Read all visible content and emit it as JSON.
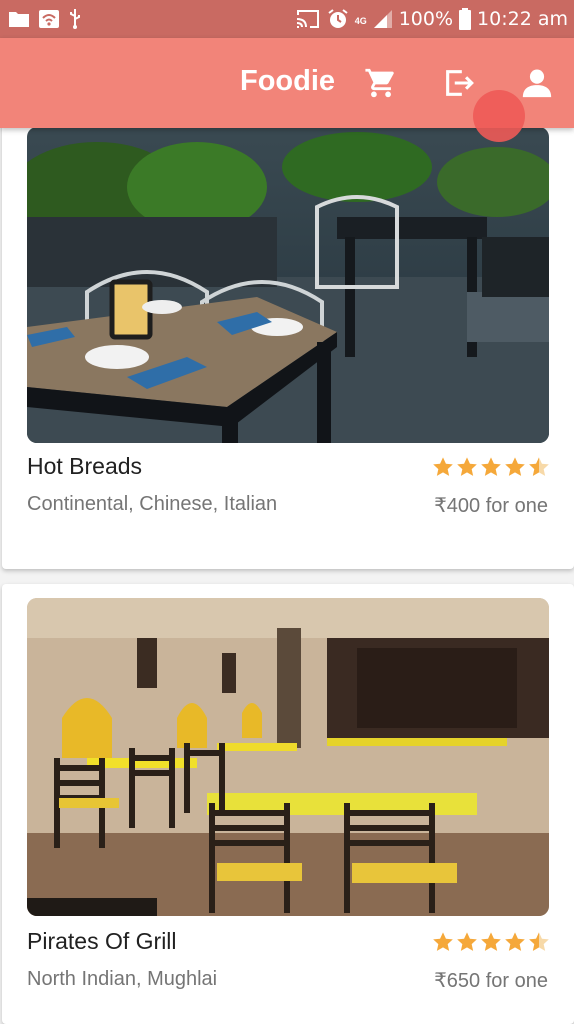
{
  "status_bar": {
    "network_type": "4G",
    "battery_text": "100%",
    "time": "10:22 am",
    "icons": [
      "folder-icon",
      "wifi-router-icon",
      "usb-icon",
      "cast-icon",
      "alarm-icon",
      "signal-icon",
      "battery-icon"
    ]
  },
  "app_bar": {
    "title": "Foodie",
    "actions": [
      "cart-icon",
      "logout-icon",
      "account-icon"
    ]
  },
  "colors": {
    "app_bar": "#f28479",
    "status_bar": "#c96a62",
    "ripple": "#ee5a56",
    "star": "#f5a83a"
  },
  "restaurants": [
    {
      "name": "Hot Breads",
      "cuisines": "Continental, Chinese, Italian",
      "price": "₹400 for one",
      "rating": 4.5,
      "image": "rooftop-restaurant-photo"
    },
    {
      "name": "Pirates Of Grill",
      "cuisines": "North Indian, Mughlai",
      "price": "₹650 for one",
      "rating": 4.5,
      "image": "restaurant-interior-photo"
    }
  ]
}
